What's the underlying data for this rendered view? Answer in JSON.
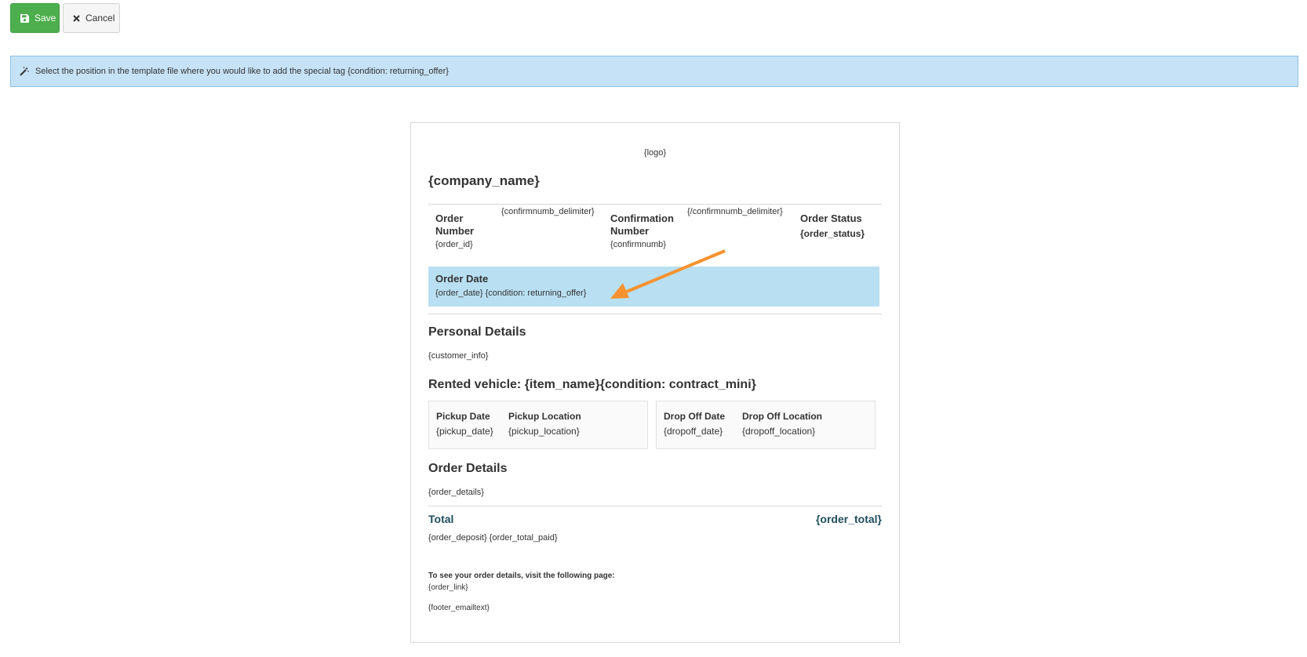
{
  "toolbar": {
    "save_label": "Save",
    "cancel_label": "Cancel"
  },
  "info": {
    "message": "Select the position in the template file where you would like to add the special tag {condition: returning_offer}"
  },
  "template": {
    "logo": "{logo}",
    "company_name": "{company_name}",
    "order_number_label": "Order Number",
    "order_id": "{order_id}",
    "confirmnumb_delimiter_open": "{confirmnumb_delimiter}",
    "confirmation_number_label": "Confirmation Number",
    "confirmnumb": "{confirmnumb}",
    "confirmnumb_delimiter_close": "{/confirmnumb_delimiter}",
    "order_status_label": "Order Status",
    "order_status": "{order_status}",
    "order_date_label": "Order Date",
    "order_date_value": "{order_date} {condition: returning_offer}",
    "personal_details_title": "Personal Details",
    "customer_info": "{customer_info}",
    "rented_vehicle_title": "Rented vehicle: {item_name}{condition: contract_mini}",
    "pickup_date_label": "Pickup Date",
    "pickup_date": "{pickup_date}",
    "pickup_location_label": "Pickup Location",
    "pickup_location": "{pickup_location}",
    "dropoff_date_label": "Drop Off Date",
    "dropoff_date": "{dropoff_date}",
    "dropoff_location_label": "Drop Off Location",
    "dropoff_location": "{dropoff_location}",
    "order_details_title": "Order Details",
    "order_details": "{order_details}",
    "total_label": "Total",
    "order_total": "{order_total}",
    "deposit_paid": "{order_deposit} {order_total_paid}",
    "visit_text": "To see your order details, visit the following page:",
    "order_link": "{order_link}",
    "footer_emailtext": "{footer_emailtext}"
  },
  "colors": {
    "save": "#4cae4c",
    "info_bg": "#c6e2f6",
    "highlight": "#b9dff2",
    "arrow": "#f5922f",
    "total": "#1f4e5f"
  }
}
